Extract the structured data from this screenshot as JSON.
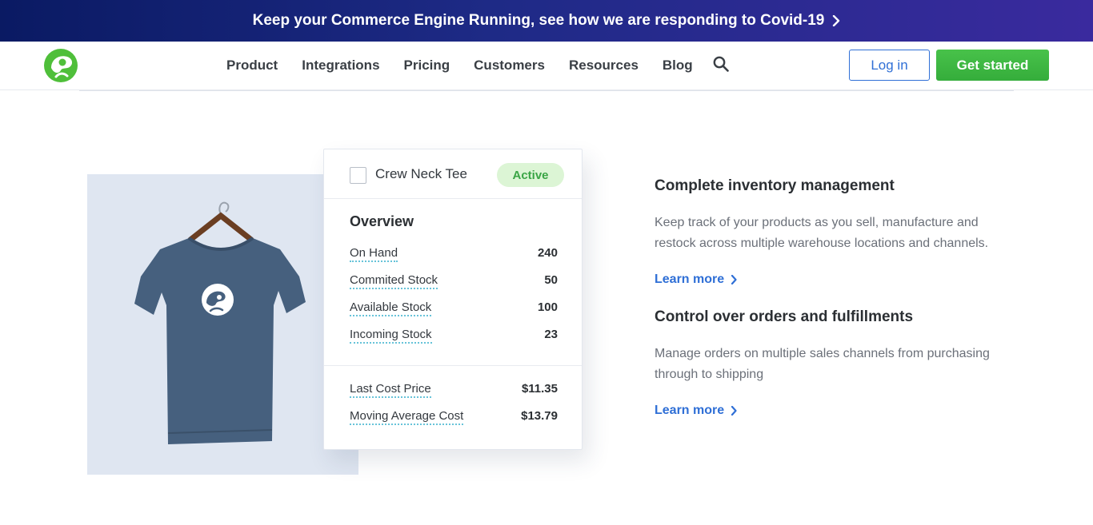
{
  "banner": {
    "text": "Keep your Commerce Engine Running, see how we are responding to Covid-19"
  },
  "nav": {
    "links": [
      "Product",
      "Integrations",
      "Pricing",
      "Customers",
      "Resources",
      "Blog"
    ],
    "login_label": "Log in",
    "get_started_label": "Get started"
  },
  "product_card": {
    "name": "Crew Neck Tee",
    "status": "Active",
    "overview_title": "Overview",
    "stats": [
      {
        "label": "On Hand",
        "value": "240"
      },
      {
        "label": "Commited Stock",
        "value": "50"
      },
      {
        "label": "Available Stock",
        "value": "100"
      },
      {
        "label": "Incoming Stock",
        "value": "23"
      }
    ],
    "costs": [
      {
        "label": "Last Cost Price",
        "value": "$11.35"
      },
      {
        "label": "Moving Average Cost",
        "value": "$13.79"
      }
    ]
  },
  "features": [
    {
      "title": "Complete inventory management",
      "description": "Keep track of your products as you sell, manufacture and restock across multiple warehouse locations and channels.",
      "link": "Learn more"
    },
    {
      "title": "Control over orders and fulfillments",
      "description": "Manage orders on multiple sales channels from purchasing through to shipping",
      "link": "Learn more"
    }
  ],
  "colors": {
    "accent": "#2f6fd6",
    "brand_green": "#3cb043",
    "banner_dark": "#0a1a63"
  }
}
